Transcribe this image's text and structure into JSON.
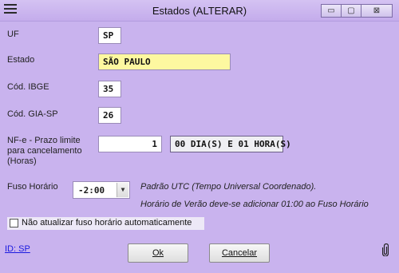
{
  "window": {
    "title": "Estados (ALTERAR)",
    "controls": {
      "minimize": "▭",
      "maximize": "▢",
      "close": "⊠"
    }
  },
  "form": {
    "uf": {
      "label": "UF",
      "value": "SP"
    },
    "estado": {
      "label": "Estado",
      "value": "SÃO PAULO"
    },
    "cod_ibge": {
      "label": "Cód. IBGE",
      "value": "35"
    },
    "cod_gia": {
      "label": "Cód. GIA-SP",
      "value": "26"
    },
    "nfe_prazo": {
      "label_line1": "NF-e - Prazo limite",
      "label_line2": "para cancelamento",
      "label_line3": "(Horas)",
      "value": "1",
      "computed": "00 DIA(S) E 01 HORA(S)"
    },
    "fuso": {
      "label": "Fuso Horário",
      "value": "-2:00",
      "note1": "Padrão UTC (Tempo Universal Coordenado).",
      "note2": "Horário de Verão deve-se adicionar 01:00 ao Fuso Horário"
    },
    "nao_atualizar": {
      "label": "Não atualizar fuso horário automaticamente",
      "checked": false
    }
  },
  "footer": {
    "id_link": "ID: SP",
    "ok": "Ok",
    "cancel": "Cancelar"
  },
  "icons": [
    "menu-icon",
    "minimize-icon",
    "maximize-icon",
    "close-icon",
    "chevron-down-icon",
    "paperclip-icon"
  ],
  "colors": {
    "background": "#c9b3ee",
    "highlight_field": "#fdf8a0",
    "link": "#1a1adf"
  }
}
